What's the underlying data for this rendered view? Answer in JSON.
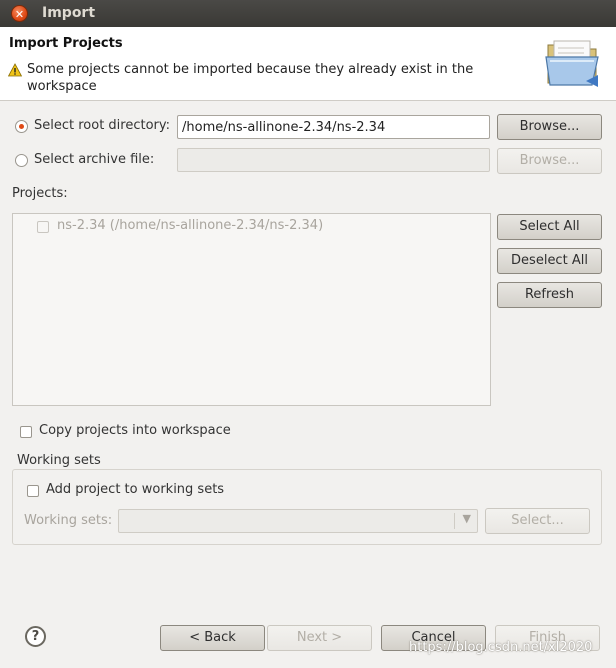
{
  "window": {
    "title": "Import"
  },
  "header": {
    "title": "Import Projects",
    "warning": "Some projects cannot be imported because they already exist in the workspace"
  },
  "source": {
    "root_label": "Select root directory:",
    "root_value": "/home/ns-allinone-2.34/ns-2.34",
    "root_selected": true,
    "browse_label": "Browse...",
    "archive_label": "Select archive file:",
    "archive_value": "",
    "archive_browse_label": "Browse..."
  },
  "projects": {
    "label": "Projects:",
    "items": [
      {
        "label": "ns-2.34 (/home/ns-allinone-2.34/ns-2.34)",
        "checked": false,
        "enabled": false
      }
    ],
    "select_all_label": "Select All",
    "deselect_all_label": "Deselect All",
    "refresh_label": "Refresh"
  },
  "options": {
    "copy_label": "Copy projects into workspace",
    "copy_checked": false
  },
  "working_sets": {
    "group_label": "Working sets",
    "add_label": "Add project to working sets",
    "add_checked": false,
    "sets_label": "Working sets:",
    "sets_value": "",
    "select_label": "Select..."
  },
  "footer": {
    "back_label": "< Back",
    "next_label": "Next >",
    "cancel_label": "Cancel",
    "finish_label": "Finish"
  },
  "watermark": "https://blog.csdn.net/xl2020",
  "icons": {
    "close": "close-icon",
    "warning": "warning-icon",
    "folder": "folder-icon",
    "help": "help-icon"
  },
  "colors": {
    "accent": "#df4a16",
    "titlebar": "#3a3935",
    "dialog_bg": "#f2f1ef"
  }
}
